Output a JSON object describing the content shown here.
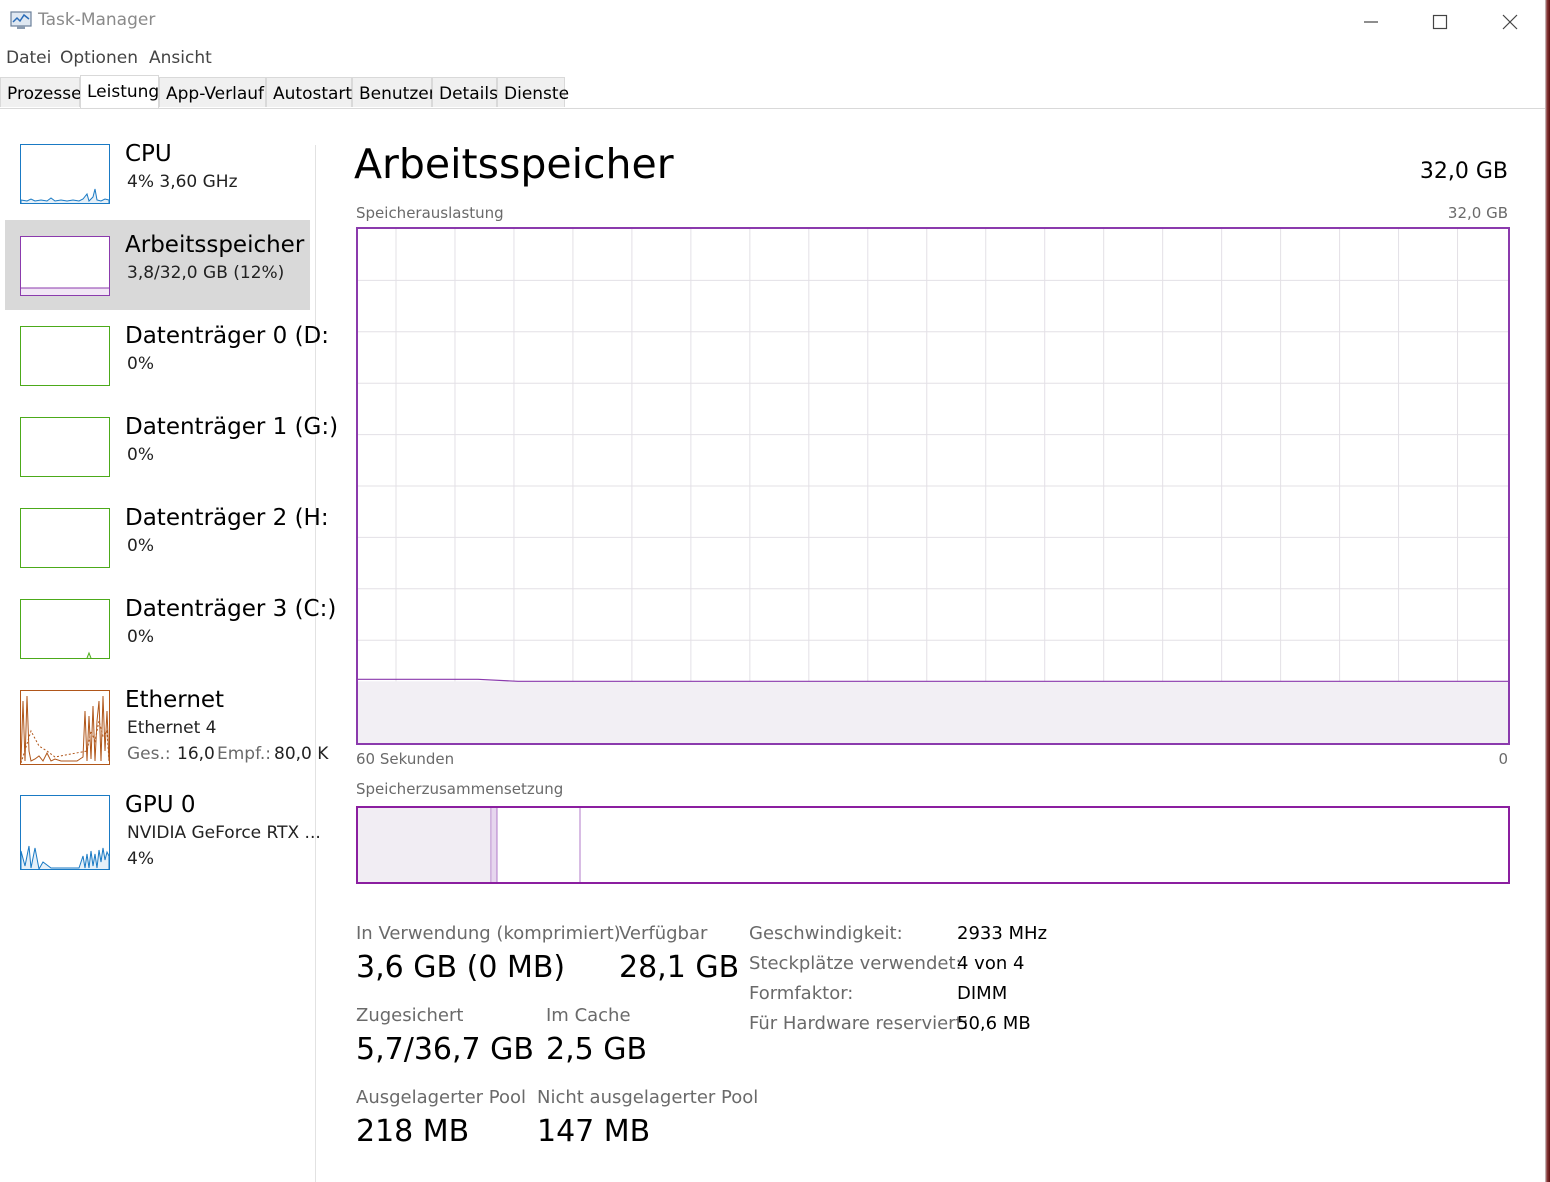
{
  "window": {
    "title": "Task-Manager"
  },
  "menu": [
    "Datei",
    "Optionen",
    "Ansicht"
  ],
  "tabs": [
    "Prozesse",
    "Leistung",
    "App-Verlauf",
    "Autostart",
    "Benutzer",
    "Details",
    "Dienste"
  ],
  "active_tab": "Leistung",
  "sidebar": {
    "items": [
      {
        "title": "CPU",
        "sub": "4%  3,60 GHz",
        "color": "#1a7ac4",
        "selected": false
      },
      {
        "title": "Arbeitsspeicher",
        "sub": "3,8/32,0 GB (12%)",
        "color": "#8b3aad",
        "selected": true
      },
      {
        "title": "Datenträger 0 (D:",
        "sub": "0%",
        "color": "#4caa1a",
        "selected": false
      },
      {
        "title": "Datenträger 1 (G:)",
        "sub": "0%",
        "color": "#4caa1a",
        "selected": false
      },
      {
        "title": "Datenträger 2 (H:",
        "sub": "0%",
        "color": "#4caa1a",
        "selected": false
      },
      {
        "title": "Datenträger 3 (C:)",
        "sub": "0%",
        "color": "#4caa1a",
        "selected": false
      },
      {
        "title": "Ethernet",
        "sub": "Ethernet 4",
        "sub2_label1": "Ges.:",
        "sub2_value1": "16,0",
        "sub2_label2": "Empf.:",
        "sub2_value2": "80,0 K",
        "color": "#b0561a",
        "selected": false
      },
      {
        "title": "GPU 0",
        "sub": "NVIDIA GeForce RTX ...",
        "sub2": "4%",
        "color": "#1a7ac4",
        "selected": false
      }
    ]
  },
  "main": {
    "title": "Arbeitsspeicher",
    "total": "32,0 GB",
    "usage_caption": "Speicherauslastung",
    "usage_max": "32,0 GB",
    "axis_left": "60 Sekunden",
    "axis_right": "0",
    "usage_fraction": 0.12,
    "composition_caption": "Speicherzusammensetzung",
    "stats": {
      "in_use_label": "In Verwendung (komprimiert)",
      "in_use_value": "3,6 GB (0 MB)",
      "available_label": "Verfügbar",
      "available_value": "28,1 GB",
      "committed_label": "Zugesichert",
      "committed_value": "5,7/36,7 GB",
      "cached_label": "Im Cache",
      "cached_value": "2,5 GB",
      "paged_label": "Ausgelagerter Pool",
      "paged_value": "218 MB",
      "nonpaged_label": "Nicht ausgelagerter Pool",
      "nonpaged_value": "147 MB"
    },
    "details": {
      "speed_label": "Geschwindigkeit:",
      "speed_value": "2933 MHz",
      "slots_label": "Steckplätze verwendet:",
      "slots_value": "4 von 4",
      "form_label": "Formfaktor:",
      "form_value": "DIMM",
      "reserved_label": "Für Hardware reserviert:",
      "reserved_value": "50,6 MB"
    }
  },
  "colors": {
    "memory": "#8b3aad",
    "disk": "#4caa1a",
    "cpu": "#1a7ac4",
    "ethernet": "#b0561a"
  }
}
